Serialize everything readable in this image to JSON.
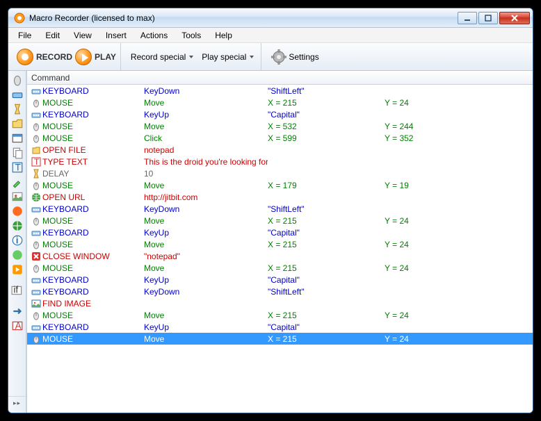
{
  "titlebar": {
    "title": "Macro Recorder (licensed to max)"
  },
  "menu": [
    "File",
    "Edit",
    "View",
    "Insert",
    "Actions",
    "Tools",
    "Help"
  ],
  "toolbar": {
    "record": "RECORD",
    "play": "PLAY",
    "record_special": "Record special",
    "play_special": "Play special",
    "settings": "Settings"
  },
  "grid": {
    "header": "Command",
    "rows": [
      {
        "icon": "keyboard",
        "color": "blue",
        "c1": "KEYBOARD",
        "c2": "KeyDown",
        "c3": "\"ShiftLeft\"",
        "c4": ""
      },
      {
        "icon": "mouse",
        "color": "green",
        "c1": "MOUSE",
        "c2": "Move",
        "c3": "X = 215",
        "c4": "Y = 24"
      },
      {
        "icon": "keyboard",
        "color": "blue",
        "c1": "KEYBOARD",
        "c2": "KeyUp",
        "c3": "\"Capital\"",
        "c4": ""
      },
      {
        "icon": "mouse",
        "color": "green",
        "c1": "MOUSE",
        "c2": "Move",
        "c3": "X = 532",
        "c4": "Y = 244"
      },
      {
        "icon": "mouse",
        "color": "green",
        "c1": "MOUSE",
        "c2": "Click",
        "c3": "X = 599",
        "c4": "Y = 352"
      },
      {
        "icon": "file",
        "color": "red",
        "c1": "OPEN FILE",
        "c2": "notepad",
        "c3": "",
        "c4": ""
      },
      {
        "icon": "text",
        "color": "red",
        "c1": "TYPE TEXT",
        "c2": "This is the droid you're looking for!",
        "c3": "",
        "c4": ""
      },
      {
        "icon": "delay",
        "color": "gray",
        "c1": "DELAY",
        "c2": "10",
        "c3": "",
        "c4": ""
      },
      {
        "icon": "mouse",
        "color": "green",
        "c1": "MOUSE",
        "c2": "Move",
        "c3": "X = 179",
        "c4": "Y = 19"
      },
      {
        "icon": "url",
        "color": "red",
        "c1": "OPEN URL",
        "c2": "http://jitbit.com",
        "c3": "",
        "c4": ""
      },
      {
        "icon": "keyboard",
        "color": "blue",
        "c1": "KEYBOARD",
        "c2": "KeyDown",
        "c3": "\"ShiftLeft\"",
        "c4": ""
      },
      {
        "icon": "mouse",
        "color": "green",
        "c1": "MOUSE",
        "c2": "Move",
        "c3": "X = 215",
        "c4": "Y = 24"
      },
      {
        "icon": "keyboard",
        "color": "blue",
        "c1": "KEYBOARD",
        "c2": "KeyUp",
        "c3": "\"Capital\"",
        "c4": ""
      },
      {
        "icon": "mouse",
        "color": "green",
        "c1": "MOUSE",
        "c2": "Move",
        "c3": "X = 215",
        "c4": "Y = 24"
      },
      {
        "icon": "close",
        "color": "red",
        "c1": "CLOSE WINDOW",
        "c2": "\"notepad\"",
        "c3": "",
        "c4": ""
      },
      {
        "icon": "mouse",
        "color": "green",
        "c1": "MOUSE",
        "c2": "Move",
        "c3": "X = 215",
        "c4": "Y = 24"
      },
      {
        "icon": "keyboard",
        "color": "blue",
        "c1": "KEYBOARD",
        "c2": "KeyUp",
        "c3": "\"Capital\"",
        "c4": ""
      },
      {
        "icon": "keyboard",
        "color": "blue",
        "c1": "KEYBOARD",
        "c2": "KeyDown",
        "c3": "\"ShiftLeft\"",
        "c4": ""
      },
      {
        "icon": "find",
        "color": "red",
        "c1": "FIND IMAGE",
        "c2": "",
        "c3": "",
        "c4": ""
      },
      {
        "icon": "mouse",
        "color": "green",
        "c1": "MOUSE",
        "c2": "Move",
        "c3": "X = 215",
        "c4": "Y = 24"
      },
      {
        "icon": "keyboard",
        "color": "blue",
        "c1": "KEYBOARD",
        "c2": "KeyUp",
        "c3": "\"Capital\"",
        "c4": ""
      },
      {
        "icon": "mouse",
        "color": "green",
        "c1": "MOUSE",
        "c2": "Move",
        "c3": "X = 215",
        "c4": "Y = 24",
        "selected": true
      }
    ]
  }
}
